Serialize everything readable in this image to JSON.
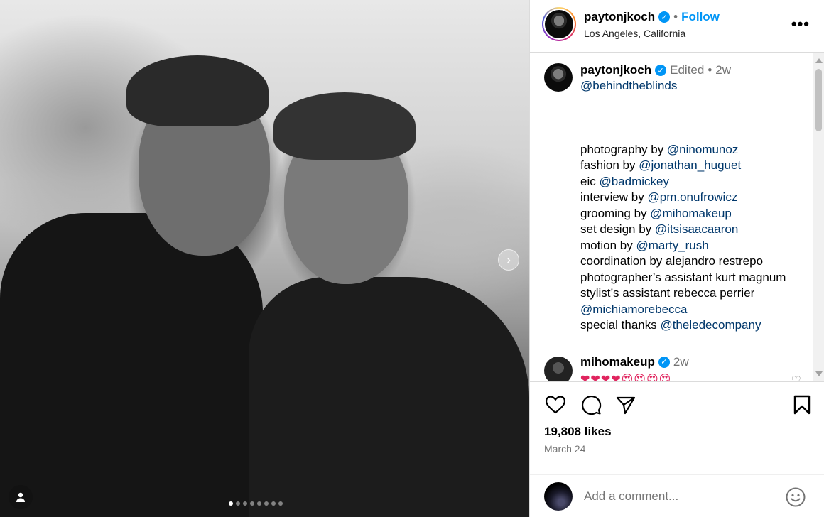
{
  "post": {
    "author": "paytonjkoch",
    "location": "Los Angeles, California",
    "follow_label": "Follow",
    "separator": "•",
    "more_label": "•••"
  },
  "media": {
    "carousel_count": 8,
    "active_index": 0,
    "next_arrow": "›"
  },
  "caption": {
    "user": "paytonjkoch",
    "edited_label": "Edited",
    "separator": "•",
    "age": "2w",
    "first_mention": "@behindtheblinds",
    "lines": [
      {
        "text": "photography by ",
        "mention": "@ninomunoz"
      },
      {
        "text": "fashion by ",
        "mention": "@jonathan_huguet"
      },
      {
        "text": "eic ",
        "mention": "@badmickey"
      },
      {
        "text": "interview by ",
        "mention": "@pm.onufrowicz"
      },
      {
        "text": "grooming by ",
        "mention": "@mihomakeup"
      },
      {
        "text": "set design by ",
        "mention": "@itsisaacaaron"
      },
      {
        "text": "motion by ",
        "mention": "@marty_rush"
      },
      {
        "text": "coordination by alejandro restrepo",
        "mention": ""
      },
      {
        "text": "photographer’s assistant kurt magnum",
        "mention": ""
      },
      {
        "text": "stylist’s assistant rebecca perrier",
        "mention": ""
      },
      {
        "text": "",
        "mention": "@michiamorebecca"
      },
      {
        "text": "special thanks ",
        "mention": "@theledecompany"
      }
    ]
  },
  "comment2": {
    "user": "mihomakeup",
    "age": "2w",
    "text": "❤❤❤❤😍😍😍😍"
  },
  "actions": {
    "likes": "19,808 likes",
    "date": "March 24"
  },
  "add_comment": {
    "placeholder": "Add a comment..."
  },
  "colors": {
    "accent": "#0095f6",
    "mention": "#00376b",
    "muted": "#737373",
    "border": "#dbdbdb"
  }
}
